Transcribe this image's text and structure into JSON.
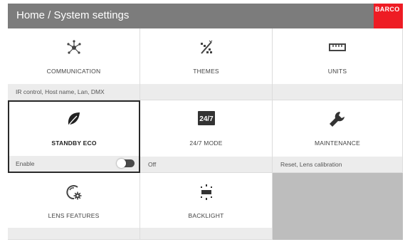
{
  "header": {
    "title": "Home / System settings",
    "brand": "BARCO",
    "background_color": "#7c7c7c",
    "brand_color": "#ee1c24"
  },
  "tiles": [
    {
      "label": "COMMUNICATION",
      "icon": "network-icon",
      "subtitle": "IR control, Host name, Lan, DMX"
    },
    {
      "label": "THEMES",
      "icon": "themes-icon",
      "subtitle": ""
    },
    {
      "label": "UNITS",
      "icon": "ruler-icon",
      "subtitle": ""
    },
    {
      "label": "STANDBY ECO",
      "icon": "leaf-icon",
      "subtitle": "Enable",
      "selected": true,
      "toggle": false
    },
    {
      "label": "24/7 MODE",
      "icon": "24-7-icon",
      "icon_text": "24/7",
      "subtitle": "Off"
    },
    {
      "label": "MAINTENANCE",
      "icon": "wrench-icon",
      "subtitle": "Reset, Lens calibration"
    },
    {
      "label": "LENS FEATURES",
      "icon": "lens-gear-icon",
      "subtitle": ""
    },
    {
      "label": "BACKLIGHT",
      "icon": "backlight-icon",
      "subtitle": ""
    }
  ]
}
